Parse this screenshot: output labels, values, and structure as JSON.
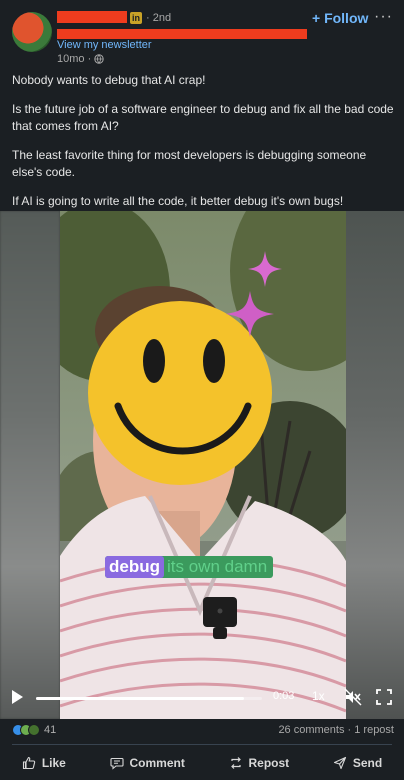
{
  "author": {
    "badge": "in",
    "degree": "· 2nd",
    "newsletter_link": "View my newsletter",
    "time": "10mo ·"
  },
  "follow_label": "+ Follow",
  "more_label": "···",
  "post": {
    "paragraphs": [
      "Nobody wants to debug that AI crap!",
      "Is the future job of a software engineer to debug and fix all the bad code that comes from AI?",
      "The least favorite thing for most developers is debugging someone else's code.",
      "If AI is going to write all the code, it better debug it's own bugs!"
    ]
  },
  "video": {
    "caption_highlight": "debug",
    "caption_rest": "its own damn",
    "time_display": "0:03",
    "speed": "1x",
    "progress": 0.92
  },
  "social": {
    "reactions_count": "41",
    "comments_reposts": "26 comments · 1 repost"
  },
  "actions": {
    "like": "Like",
    "comment": "Comment",
    "repost": "Repost",
    "send": "Send"
  },
  "colors": {
    "background": "#1b1f23",
    "accent": "#71b7fb",
    "redaction": "#ee3c1e",
    "caption_highlight": "#8a6ae0",
    "caption_bg": "#3b9a5d"
  }
}
